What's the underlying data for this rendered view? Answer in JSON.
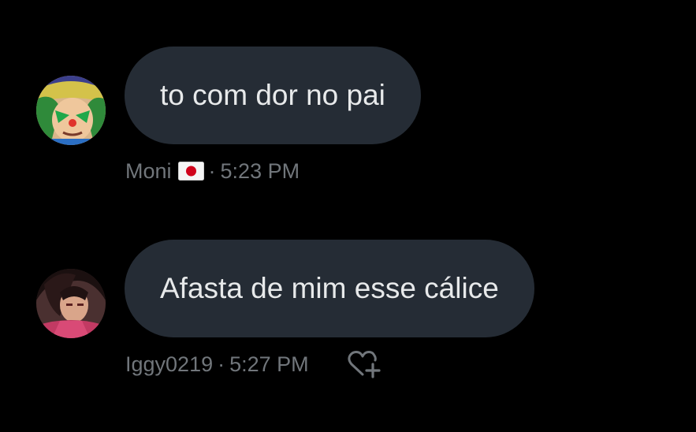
{
  "messages": [
    {
      "text": "to com dor no pai",
      "author": "Moni",
      "author_flag": "japan-flag",
      "separator": "·",
      "time": "5:23 PM"
    },
    {
      "text": "Afasta de mim esse cálice",
      "author": "Iggy0219",
      "separator": "·",
      "time": "5:27 PM",
      "reaction_icon": "heart-plus-icon"
    }
  ],
  "colors": {
    "background": "#000000",
    "bubble": "#252c35",
    "bubble_text": "#e7e9ea",
    "meta_text": "#71767b"
  }
}
